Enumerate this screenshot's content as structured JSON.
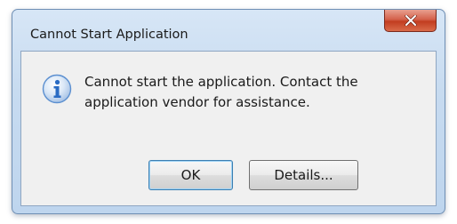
{
  "dialog": {
    "title": "Cannot Start Application",
    "message_line1": "Cannot start the application. Contact the",
    "message_line2": "application vendor for assistance.",
    "icon": "info-icon",
    "close_icon": "close-icon"
  },
  "buttons": {
    "ok_label": "OK",
    "details_label": "Details..."
  },
  "colors": {
    "close_button": "#c94a30",
    "info_icon": "#2a6cc4",
    "default_button_border": "#3c7fb1"
  }
}
